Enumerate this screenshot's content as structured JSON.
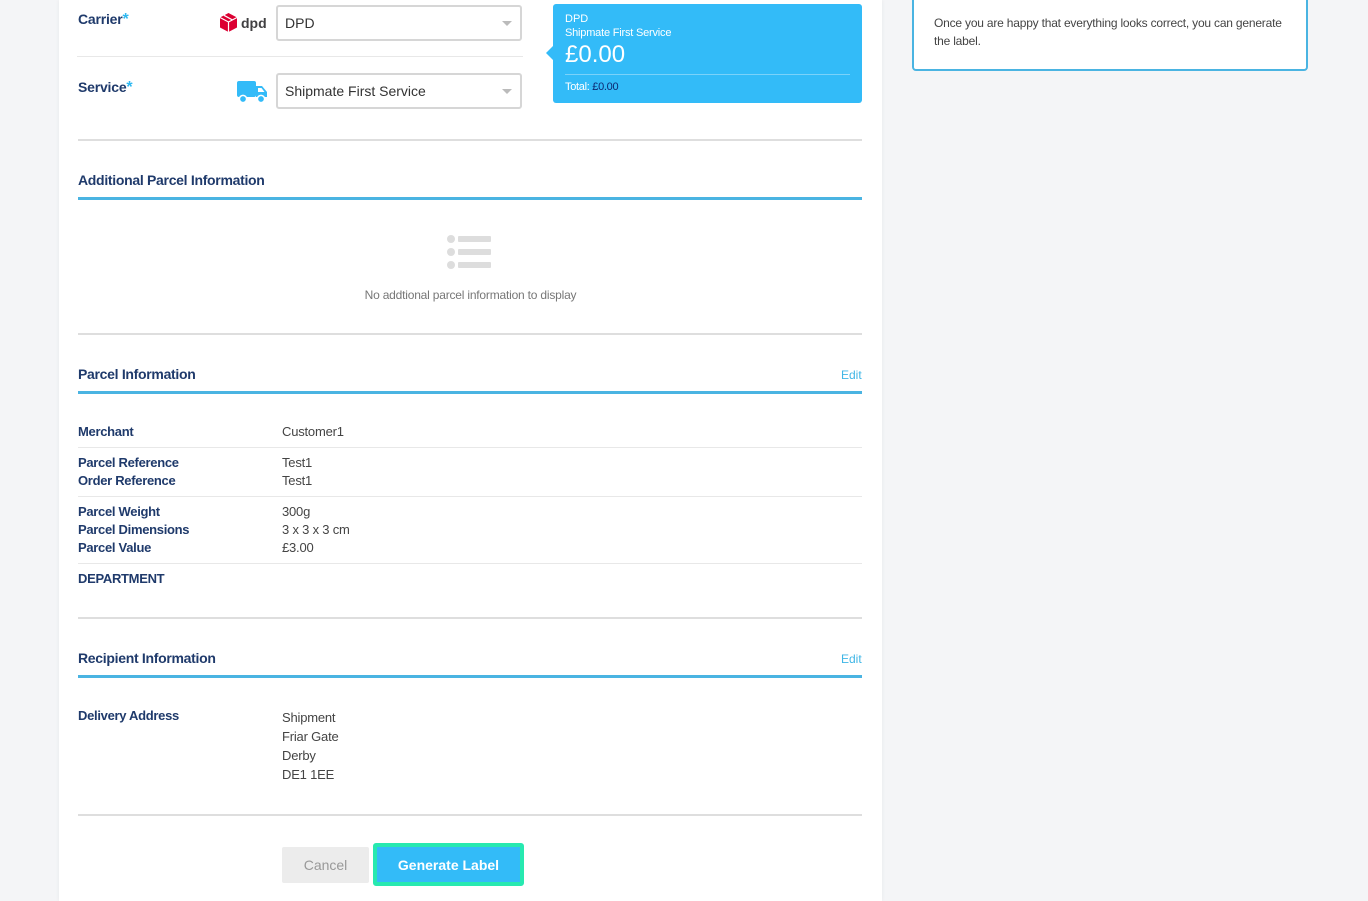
{
  "carrier": {
    "label": "Carrier",
    "required_mark": "*",
    "logo_text": "dpd",
    "selected": "DPD"
  },
  "service": {
    "label": "Service",
    "required_mark": "*",
    "selected": "Shipmate First Service"
  },
  "quote": {
    "carrier": "DPD",
    "service": "Shipmate First Service",
    "price": "£0.00",
    "total_label": "Total:",
    "total_value": "£0.00"
  },
  "info_box": {
    "text": "Once you are happy that everything looks correct, you can generate the label."
  },
  "additional_info": {
    "title": "Additional Parcel Information",
    "empty_text": "No addtional parcel information to display"
  },
  "parcel_info": {
    "title": "Parcel Information",
    "edit_label": "Edit",
    "rows": [
      {
        "label": "Merchant",
        "value": "Customer1"
      },
      {
        "label": "Parcel Reference",
        "value": "Test1"
      },
      {
        "label": "Order Reference",
        "value": "Test1"
      },
      {
        "label": "Parcel Weight",
        "value": "300g"
      },
      {
        "label": "Parcel Dimensions",
        "value": "3 x 3 x 3 cm"
      },
      {
        "label": "Parcel Value",
        "value": "£3.00"
      },
      {
        "label": "DEPARTMENT",
        "value": ""
      }
    ]
  },
  "recipient_info": {
    "title": "Recipient Information",
    "edit_label": "Edit",
    "address_label": "Delivery Address",
    "address_lines": [
      "Shipment",
      "Friar Gate",
      "Derby",
      "DE1 1EE"
    ]
  },
  "actions": {
    "cancel_label": "Cancel",
    "generate_label": "Generate Label"
  },
  "colors": {
    "accent": "#33bbf8",
    "focus_ring": "#27e9b0",
    "heading": "#1f3a6b",
    "dpd_red": "#dc0032"
  }
}
